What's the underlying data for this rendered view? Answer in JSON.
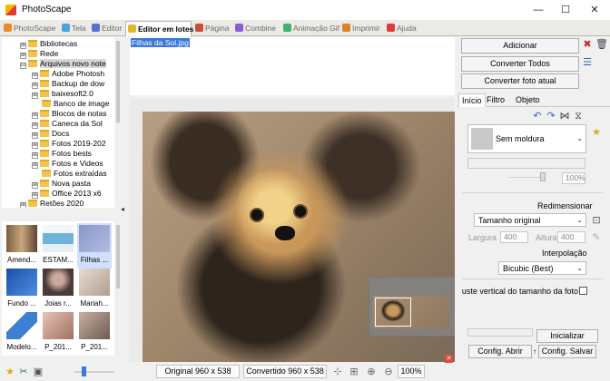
{
  "window": {
    "title": "PhotoScape",
    "minimize": "—",
    "maximize": "☐",
    "close": "✕"
  },
  "tabs": [
    {
      "label": "PhotoScape",
      "color": "#e98a2c"
    },
    {
      "label": "Tela",
      "color": "#4aa3df"
    },
    {
      "label": "Editor",
      "color": "#5a6fd6"
    },
    {
      "label": "Editor em lotes",
      "color": "#e4b62c",
      "active": true
    },
    {
      "label": "Página",
      "color": "#c94e3b"
    },
    {
      "label": "Combine",
      "color": "#8c5bd6"
    },
    {
      "label": "Animação Gif",
      "color": "#3cb371"
    },
    {
      "label": "Imprimir",
      "color": "#d9822b"
    },
    {
      "label": "Ajuda",
      "color": "#e03a3a"
    }
  ],
  "tree": {
    "items": [
      {
        "label": "Bibliotecas",
        "expander": "⊞"
      },
      {
        "label": "Rede",
        "expander": "⊞"
      },
      {
        "label": "Arquivos novo note",
        "expander": "⊟",
        "selected": true
      },
      {
        "label": "Adobe Photosh",
        "expander": "⊞"
      },
      {
        "label": "Backup de dow",
        "expander": "⊞"
      },
      {
        "label": "baixesoft2.0",
        "expander": "⊞"
      },
      {
        "label": "Banco de image",
        "expander": ""
      },
      {
        "label": "Blocos de notas",
        "expander": "⊞"
      },
      {
        "label": "Caneca da Sol",
        "expander": "⊞"
      },
      {
        "label": "Docs",
        "expander": "⊞"
      },
      {
        "label": "Fotos 2019-202",
        "expander": "⊞"
      },
      {
        "label": "Fotos bests",
        "expander": "⊞"
      },
      {
        "label": "Fotos e Videos",
        "expander": "⊞"
      },
      {
        "label": "Fotos extraídas",
        "expander": ""
      },
      {
        "label": "Nova pasta",
        "expander": "⊞"
      },
      {
        "label": "Office 2013 x6",
        "expander": "⊞"
      },
      {
        "label": "Retões 2020",
        "expander": "⊞"
      }
    ]
  },
  "thumbnails": [
    {
      "caption": "Amend...",
      "color": "#b7a07c"
    },
    {
      "caption": "ESTAM...",
      "color": "#6fb3d8"
    },
    {
      "caption": "Filhas ...",
      "color": "#8a96c8",
      "selected": true
    },
    {
      "caption": "Fundo ...",
      "color": "#3a6fc6"
    },
    {
      "caption": "Joias r...",
      "color": "#6e5a58"
    },
    {
      "caption": "Mariah...",
      "color": "#c7b3a5"
    },
    {
      "caption": "Modelo...",
      "color": "#3d7fd1"
    },
    {
      "caption": "P_201...",
      "color": "#cfa79a"
    },
    {
      "caption": "P_201...",
      "color": "#9f8577"
    }
  ],
  "file_list": {
    "selected_file": "Filhas da Sol.jpg"
  },
  "right_panel": {
    "add_button": "Adicionar",
    "convert_all_button": "Converter Todos",
    "convert_current_button": "Converter foto atual",
    "subtabs": [
      "Início",
      "Filtro",
      "Objeto"
    ],
    "frame_combo": "Sem moldura",
    "frame_percent": "100%",
    "resize_title": "Redimensionar",
    "resize_combo": "Tamanho original",
    "width_label": "Largura",
    "width_value": "400",
    "height_label": "Altura",
    "height_value": "400",
    "interp_title": "Interpolação",
    "interp_combo": "Bicubic (Best)",
    "vertical_adjust_label": "Ajuste vertical do tamanho da foto",
    "init_button": "Inicializar",
    "open_config_button": "Config. Abrir",
    "save_config_button": "Config. Salvar"
  },
  "status": {
    "original": "Original 960 x 538",
    "converted": "Convertido 960 x 538",
    "zoom": "100%"
  }
}
